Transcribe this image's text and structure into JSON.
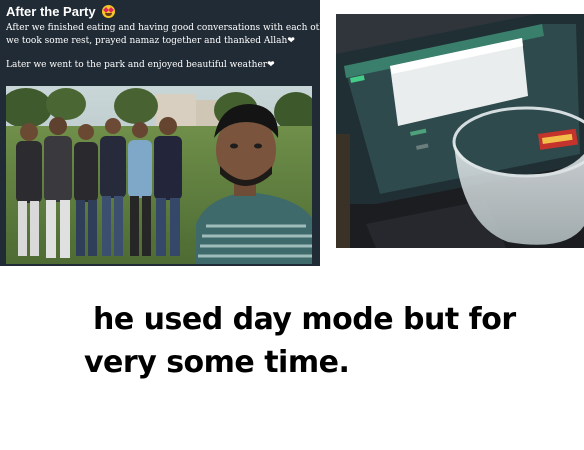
{
  "post": {
    "title": "After the Party",
    "title_emoji": "star-struck-emoji",
    "line1": "After we finished eating and having good conversations with each other,",
    "line2": "we took some rest, prayed namaz together and thanked Allah",
    "line3": "Later we went to the park and enjoyed beautiful weather",
    "heart": "❤"
  },
  "photos": {
    "group_photo": "group-selfie-in-park",
    "laptop_photo": "laptop-screen-with-glass"
  },
  "caption": {
    "line1": "he used day mode but for",
    "line2": "very some time."
  },
  "colors": {
    "post_background": "#212b35",
    "caption_text": "#000000"
  }
}
